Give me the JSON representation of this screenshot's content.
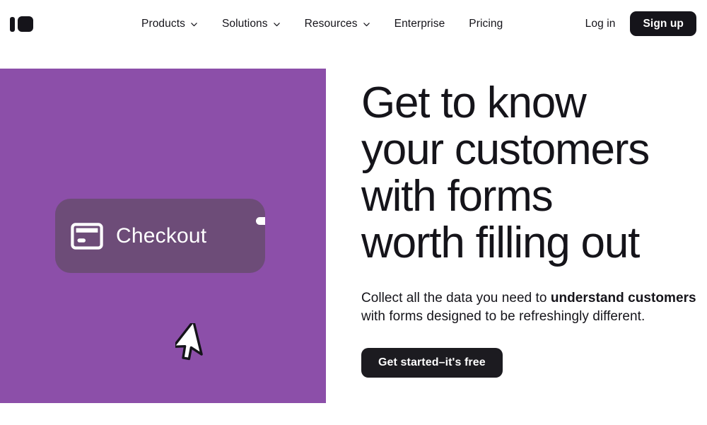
{
  "brand": {
    "logo_name": "typeform-logo",
    "logo_color": "#15141a"
  },
  "header": {
    "nav": [
      {
        "label": "Products",
        "has_dropdown": true,
        "icon": "chevron-down-icon"
      },
      {
        "label": "Solutions",
        "has_dropdown": true,
        "icon": "chevron-down-icon"
      },
      {
        "label": "Resources",
        "has_dropdown": true,
        "icon": "chevron-down-icon"
      },
      {
        "label": "Enterprise",
        "has_dropdown": false,
        "icon": ""
      },
      {
        "label": "Pricing",
        "has_dropdown": false,
        "icon": ""
      }
    ],
    "login_label": "Log in",
    "signup_label": "Sign up",
    "signup_bg": "#15141a",
    "signup_text_color": "#ffffff"
  },
  "hero": {
    "visual": {
      "background_color": "#8c4fa9",
      "card": {
        "background_color": "#6d4c78",
        "icon_name": "credit-card-icon",
        "label": "Checkout",
        "label_color": "#ffffff",
        "edge_pill_name": "card-edge-pill",
        "edge_pill_color": "#ffffff"
      },
      "cursor_icon": "mouse-cursor-icon"
    },
    "headline_lines": [
      "Get to know",
      "your customers",
      "with forms",
      "worth filling out"
    ],
    "subcopy": {
      "part1": "Collect all the data you need to ",
      "bold1": "understand customers",
      "part2": " with forms designed to be refreshingly different."
    },
    "cta_label": "Get started–it's free",
    "cta_bg": "#1c1b20",
    "cta_text_color": "#ffffff"
  }
}
